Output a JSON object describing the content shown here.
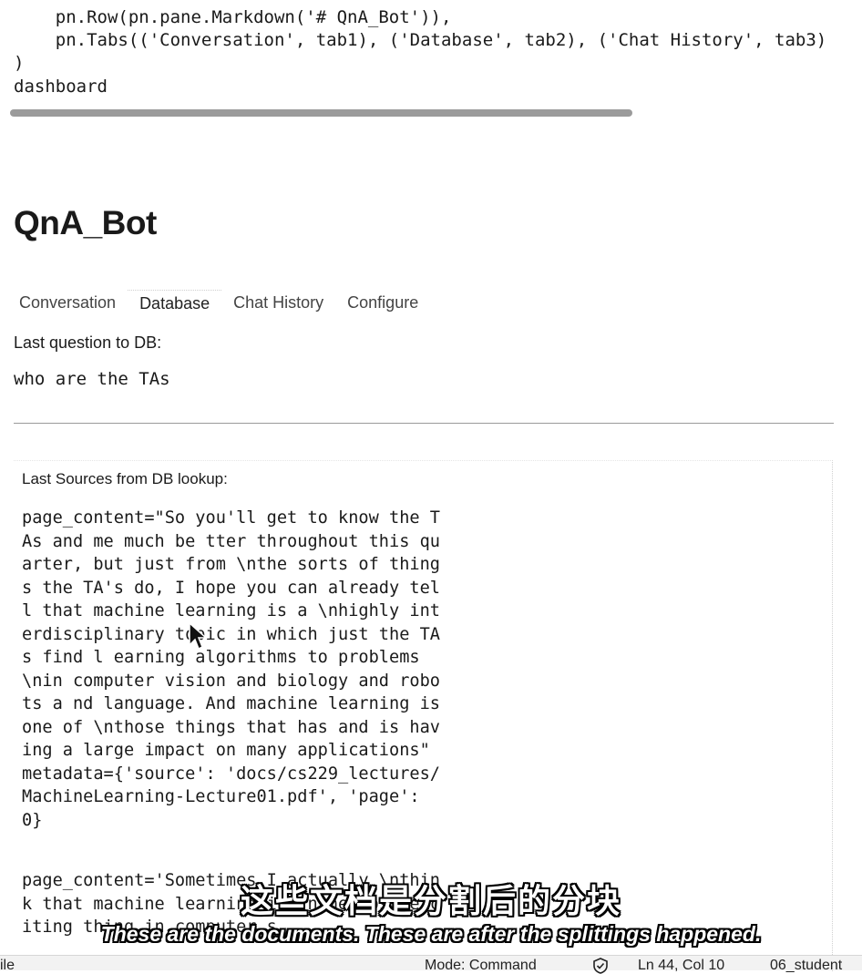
{
  "code": {
    "line1": "    pn.Row(pn.pane.Markdown('# QnA_Bot')),",
    "line2": "    pn.Tabs(('Conversation', tab1), ('Database', tab2), ('Chat History', tab3)",
    "line3": ")",
    "line4": "dashboard"
  },
  "app": {
    "title": "QnA_Bot",
    "tabs": [
      {
        "label": "Conversation"
      },
      {
        "label": "Database"
      },
      {
        "label": "Chat History"
      },
      {
        "label": "Configure"
      }
    ]
  },
  "database_tab": {
    "last_question_label": "Last question to DB:",
    "last_question": "who are the TAs",
    "sources_label": "Last Sources from DB lookup:",
    "documents": [
      {
        "text": "page_content=\"So you'll get to know the TAs and me much be tter throughout this quarter, but just from \\nthe sorts of things the TA's do, I hope you can already tell that machine learning is a \\nhighly interdisciplinary topic in which just the TAs find l earning algorithms to problems \\nin computer vision and biology and robots a nd language. And machine learning is one of \\nthose things that has and is having a large impact on many applications\" metadata={'source': 'docs/cs229_lectures/MachineLearning-Lecture01.pdf', 'page': 0}"
      },
      {
        "text": "page_content='Sometimes I actually \\nthink that machine learning is \\nthe most exciting thing in computer s"
      }
    ]
  },
  "subtitles": {
    "zh": "这些文档是分割后的分块",
    "en": "These are the documents. These are after the splittings happened."
  },
  "statusbar": {
    "left": "ile",
    "mode": "Mode: Command",
    "position": "Ln 44, Col 10",
    "file": "06_student"
  }
}
